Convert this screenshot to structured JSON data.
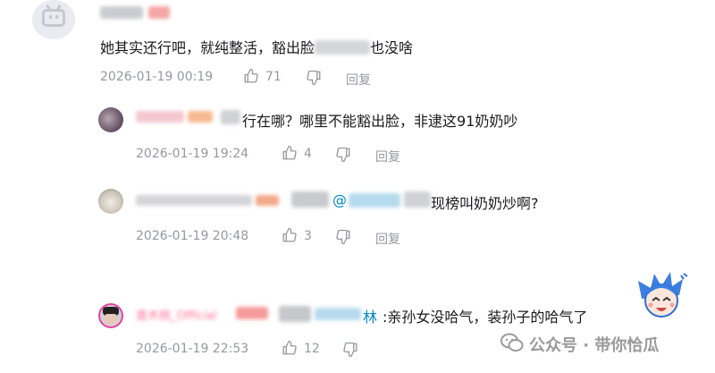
{
  "main_comment": {
    "text_a": "她其实还行吧，就纯整活，豁出脸",
    "text_b": "也没啥",
    "date": "2026-01-19 00:19",
    "likes": "71",
    "reply_label": "回复"
  },
  "replies": [
    {
      "text_a": "行在哪？哪里不能豁出脸，非逮这91奶奶吵",
      "date": "2026-01-19 19:24",
      "likes": "4",
      "reply_label": "回复"
    },
    {
      "text_a": "@",
      "text_b": "现榜叫奶奶炒啊?",
      "date": "2026-01-19 20:48",
      "likes": "3",
      "reply_label": "回复"
    },
    {
      "username": "直木桃_Official",
      "text_a": "林",
      "text_b": ":亲孙女没哈气，装孙子的哈气了",
      "date": "2026-01-19 22:53",
      "likes": "12",
      "reply_label": "回复"
    }
  ],
  "watermark": "公众号 · 带你恰瓜",
  "colors": {
    "meta": "#9499a0",
    "text": "#18191c",
    "link": "#008ac5"
  }
}
